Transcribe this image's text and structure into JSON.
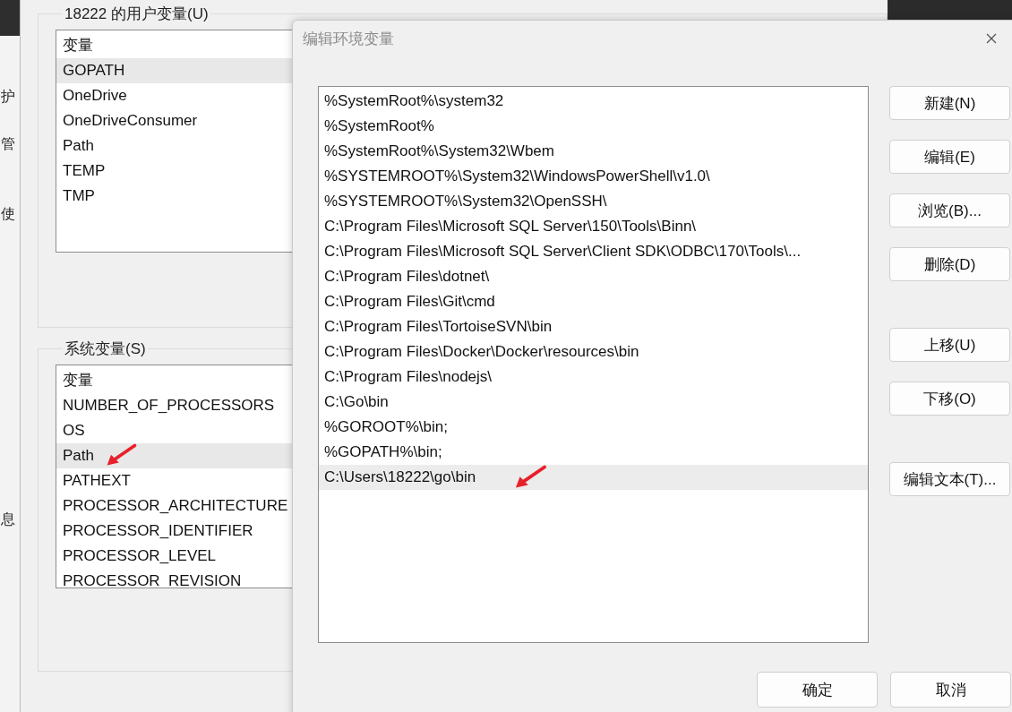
{
  "side_strip": {
    "items": [
      "护",
      "管",
      "使",
      "息"
    ]
  },
  "background_window": {
    "user_variables": {
      "title": "18222 的用户变量(U)",
      "column": "变量",
      "rows": [
        {
          "name": "GOPATH",
          "selected": true,
          "marked": false
        },
        {
          "name": "OneDrive",
          "selected": false,
          "marked": false
        },
        {
          "name": "OneDriveConsumer",
          "selected": false,
          "marked": false
        },
        {
          "name": "Path",
          "selected": false,
          "marked": false
        },
        {
          "name": "TEMP",
          "selected": false,
          "marked": false
        },
        {
          "name": "TMP",
          "selected": false,
          "marked": false
        }
      ]
    },
    "system_variables": {
      "title": "系统变量(S)",
      "column": "变量",
      "rows": [
        {
          "name": "NUMBER_OF_PROCESSORS",
          "selected": false,
          "marked": false
        },
        {
          "name": "OS",
          "selected": false,
          "marked": false
        },
        {
          "name": "Path",
          "selected": true,
          "marked": true
        },
        {
          "name": "PATHEXT",
          "selected": false,
          "marked": false
        },
        {
          "name": "PROCESSOR_ARCHITECTURE",
          "selected": false,
          "marked": false
        },
        {
          "name": "PROCESSOR_IDENTIFIER",
          "selected": false,
          "marked": false
        },
        {
          "name": "PROCESSOR_LEVEL",
          "selected": false,
          "marked": false
        },
        {
          "name": "PROCESSOR_REVISION",
          "selected": false,
          "marked": false
        }
      ]
    }
  },
  "dialog": {
    "title": "编辑环境变量",
    "entries": [
      {
        "text": "%SystemRoot%\\system32",
        "selected": false,
        "marked": false
      },
      {
        "text": "%SystemRoot%",
        "selected": false,
        "marked": false
      },
      {
        "text": "%SystemRoot%\\System32\\Wbem",
        "selected": false,
        "marked": false
      },
      {
        "text": "%SYSTEMROOT%\\System32\\WindowsPowerShell\\v1.0\\",
        "selected": false,
        "marked": false
      },
      {
        "text": "%SYSTEMROOT%\\System32\\OpenSSH\\",
        "selected": false,
        "marked": false
      },
      {
        "text": "C:\\Program Files\\Microsoft SQL Server\\150\\Tools\\Binn\\",
        "selected": false,
        "marked": false
      },
      {
        "text": "C:\\Program Files\\Microsoft SQL Server\\Client SDK\\ODBC\\170\\Tools\\...",
        "selected": false,
        "marked": false
      },
      {
        "text": "C:\\Program Files\\dotnet\\",
        "selected": false,
        "marked": false
      },
      {
        "text": "C:\\Program Files\\Git\\cmd",
        "selected": false,
        "marked": false
      },
      {
        "text": "C:\\Program Files\\TortoiseSVN\\bin",
        "selected": false,
        "marked": false
      },
      {
        "text": "C:\\Program Files\\Docker\\Docker\\resources\\bin",
        "selected": false,
        "marked": false
      },
      {
        "text": "C:\\Program Files\\nodejs\\",
        "selected": false,
        "marked": false
      },
      {
        "text": "C:\\Go\\bin",
        "selected": false,
        "marked": false
      },
      {
        "text": "%GOROOT%\\bin;",
        "selected": false,
        "marked": false
      },
      {
        "text": "%GOPATH%\\bin;",
        "selected": false,
        "marked": false
      },
      {
        "text": "C:\\Users\\18222\\go\\bin",
        "selected": true,
        "marked": true
      }
    ],
    "side_button_groups": [
      [
        "新建(N)",
        "编辑(E)",
        "浏览(B)...",
        "删除(D)"
      ],
      [
        "上移(U)",
        "下移(O)"
      ],
      [
        "编辑文本(T)..."
      ]
    ],
    "footer_buttons": [
      "确定",
      "取消"
    ]
  }
}
